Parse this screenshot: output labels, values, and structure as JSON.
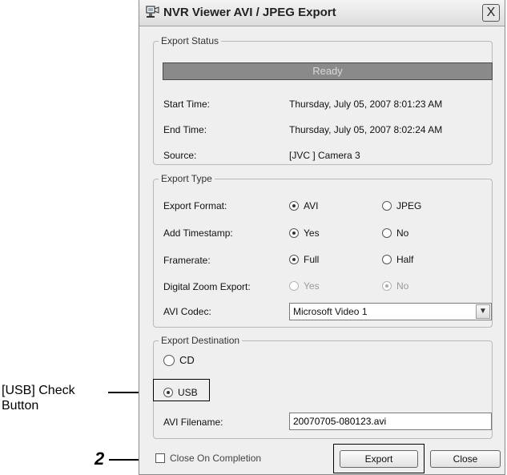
{
  "window": {
    "title": "NVR Viewer AVI / JPEG Export",
    "close_label": "X"
  },
  "export_status": {
    "legend": "Export Status",
    "status_text": "Ready",
    "rows": [
      {
        "label": "Start Time:",
        "value": "Thursday, July 05, 2007 8:01:23 AM"
      },
      {
        "label": "End Time:",
        "value": "Thursday, July 05, 2007 8:02:24 AM"
      },
      {
        "label": "Source:",
        "value": "[JVC ] Camera 3"
      }
    ]
  },
  "export_type": {
    "legend": "Export Type",
    "format": {
      "label": "Export Format:",
      "opt1": "AVI",
      "opt2": "JPEG",
      "selected": "AVI"
    },
    "timestamp": {
      "label": "Add Timestamp:",
      "opt1": "Yes",
      "opt2": "No",
      "selected": "Yes"
    },
    "framerate": {
      "label": "Framerate:",
      "opt1": "Full",
      "opt2": "Half",
      "selected": "Full"
    },
    "digital_zoom": {
      "label": "Digital Zoom Export:",
      "opt1": "Yes",
      "opt2": "No",
      "selected": "No",
      "disabled": true
    },
    "codec": {
      "label": "AVI Codec:",
      "value": "Microsoft Video 1"
    }
  },
  "export_destination": {
    "legend": "Export Destination",
    "cd_label": "CD",
    "usb_label": "USB",
    "selected": "USB",
    "filename_label": "AVI Filename:",
    "filename_value": "20070705-080123.avi"
  },
  "footer": {
    "close_on_completion": "Close On Completion",
    "export_button": "Export",
    "close_button": "Close"
  },
  "annotations": {
    "usb_callout_line1": "[USB] Check",
    "usb_callout_line2": "Button",
    "step_number": "2"
  }
}
